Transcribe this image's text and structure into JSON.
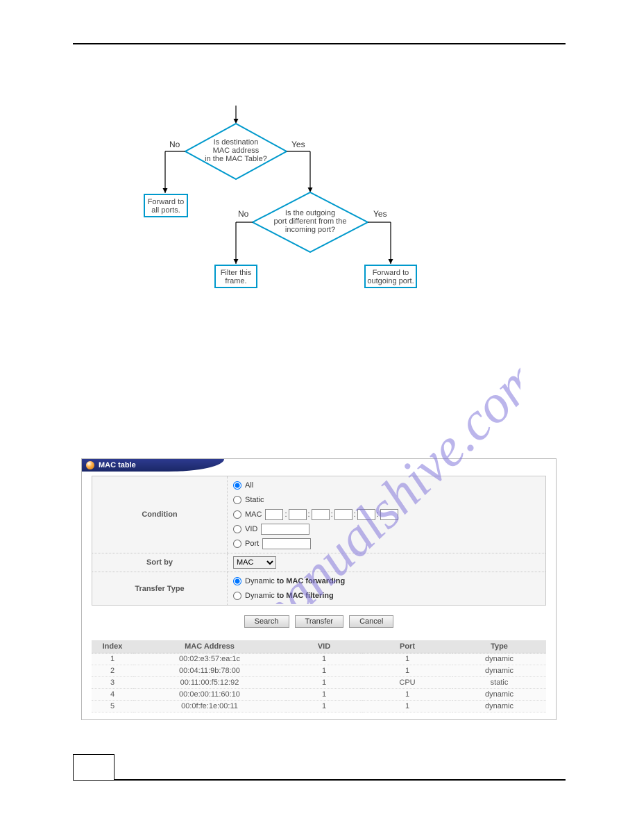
{
  "watermark": "manualshive.com",
  "flowchart": {
    "decision1": "Is destination\nMAC address\nin the MAC Table?",
    "decision2": "Is the outgoing\nport different from the\nincoming port?",
    "box_forward_all": "Forward to\nall ports.",
    "box_filter": "Filter this\nframe.",
    "box_forward_out": "Forward to\noutgoing port.",
    "no": "No",
    "yes": "Yes"
  },
  "panel": {
    "title": "MAC table",
    "labels": {
      "condition": "Condition",
      "sortby": "Sort by",
      "transfer_type": "Transfer Type"
    },
    "radios": {
      "all": "All",
      "static": "Static",
      "mac": "MAC",
      "vid": "VID",
      "port": "Port",
      "dyn_fwd": "Dynamic to MAC forwarding",
      "dyn_filt": "Dynamic to MAC filtering"
    },
    "sortby_selected": "MAC",
    "buttons": {
      "search": "Search",
      "transfer": "Transfer",
      "cancel": "Cancel"
    },
    "table": {
      "headers": [
        "Index",
        "MAC Address",
        "VID",
        "Port",
        "Type"
      ],
      "rows": [
        {
          "index": "1",
          "mac": "00:02:e3:57:ea:1c",
          "vid": "1",
          "port": "1",
          "type": "dynamic"
        },
        {
          "index": "2",
          "mac": "00:04:11:9b:78:00",
          "vid": "1",
          "port": "1",
          "type": "dynamic"
        },
        {
          "index": "3",
          "mac": "00:11:00:f5:12:92",
          "vid": "1",
          "port": "CPU",
          "type": "static"
        },
        {
          "index": "4",
          "mac": "00:0e:00:11:60:10",
          "vid": "1",
          "port": "1",
          "type": "dynamic"
        },
        {
          "index": "5",
          "mac": "00:0f:fe:1e:00:11",
          "vid": "1",
          "port": "1",
          "type": "dynamic"
        }
      ]
    }
  }
}
